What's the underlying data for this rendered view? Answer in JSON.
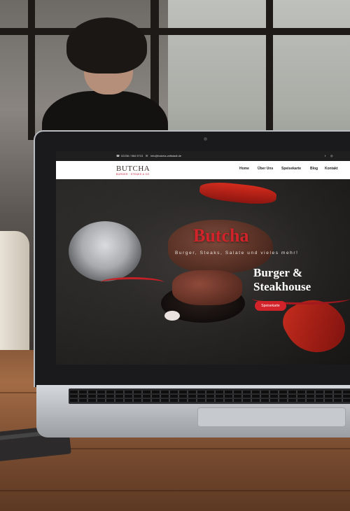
{
  "site": {
    "topbar": {
      "phone": "02236 / 984 9713",
      "email": "info@butcha-wittstadt.de",
      "social": [
        "f",
        "◎"
      ]
    },
    "logo": {
      "name": "BUTCHA",
      "subtitle": "BURGER · STEAKS & CO"
    },
    "nav": {
      "items": [
        "Home",
        "Über Uns",
        "Speisekarte",
        "Blog",
        "Kontakt"
      ]
    },
    "hero": {
      "title": "Butcha",
      "tagline": "Burger, Steaks, Salate und vieles mehr!",
      "heading_line1": "Burger &",
      "heading_line2": "Steakhouse",
      "button": "Speisekarte"
    }
  },
  "colors": {
    "accent": "#d2232a",
    "topbar": "#1f1f1f",
    "navbar": "#ffffff"
  }
}
